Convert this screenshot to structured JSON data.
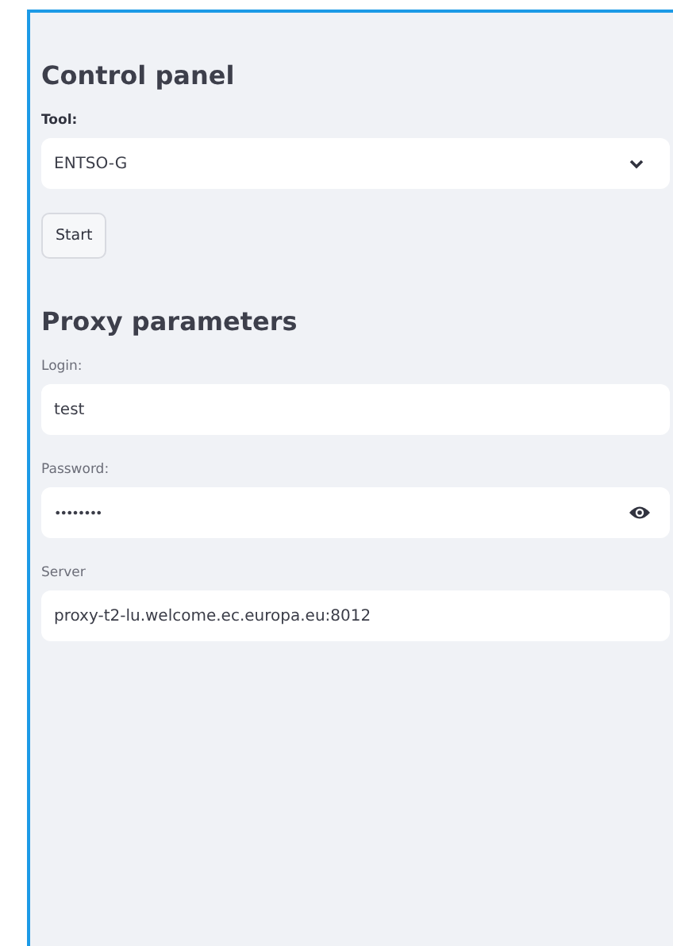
{
  "sections": [
    {
      "title": "Control panel",
      "controls": [
        {
          "kind": "select",
          "label": "Tool:",
          "value": "ENTSO-G"
        },
        {
          "kind": "button",
          "label": "Start"
        }
      ]
    },
    {
      "title": "Proxy parameters",
      "controls": [
        {
          "kind": "text",
          "label": "Login:",
          "value": "test"
        },
        {
          "kind": "password",
          "label": "Password:",
          "value": "••••••••"
        },
        {
          "kind": "text",
          "label": "Server",
          "value": "proxy-t2-lu.welcome.ec.europa.eu:8012"
        }
      ]
    }
  ]
}
